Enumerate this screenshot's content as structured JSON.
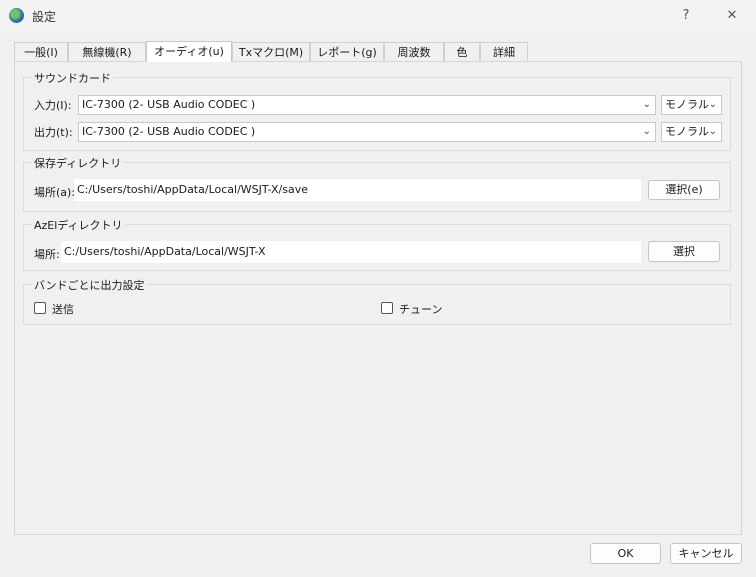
{
  "window": {
    "title": "設定",
    "help": "?",
    "close": "✕"
  },
  "tabs": [
    {
      "label": "一般(I)"
    },
    {
      "label": "無線機(R)"
    },
    {
      "label": "オーディオ(u)"
    },
    {
      "label": "Txマクロ(M)"
    },
    {
      "label": "レポート(g)"
    },
    {
      "label": "周波数"
    },
    {
      "label": "色"
    },
    {
      "label": "詳細"
    }
  ],
  "active_tab": "オーディオ(u)",
  "soundcard": {
    "title": "サウンドカード",
    "input_label": "入力(I):",
    "input_value": "IC-7300 (2- USB Audio CODEC )",
    "input_channel": "モノラル",
    "output_label": "出力(t):",
    "output_value": "IC-7300 (2- USB Audio CODEC )",
    "output_channel": "モノラル"
  },
  "save_dir": {
    "title": "保存ディレクトリ",
    "label": "場所(a):",
    "path": "C:/Users/toshi/AppData/Local/WSJT-X/save",
    "button": "選択(e)"
  },
  "azel_dir": {
    "title": "AzElディレクトリ",
    "label": "場所:",
    "path": "C:/Users/toshi/AppData/Local/WSJT-X",
    "button": "選択"
  },
  "band_output": {
    "title": "バンドごとに出力設定",
    "transmit_label": "送信",
    "tune_label": "チューン"
  },
  "footer": {
    "ok": "OK",
    "cancel": "キャンセル"
  }
}
